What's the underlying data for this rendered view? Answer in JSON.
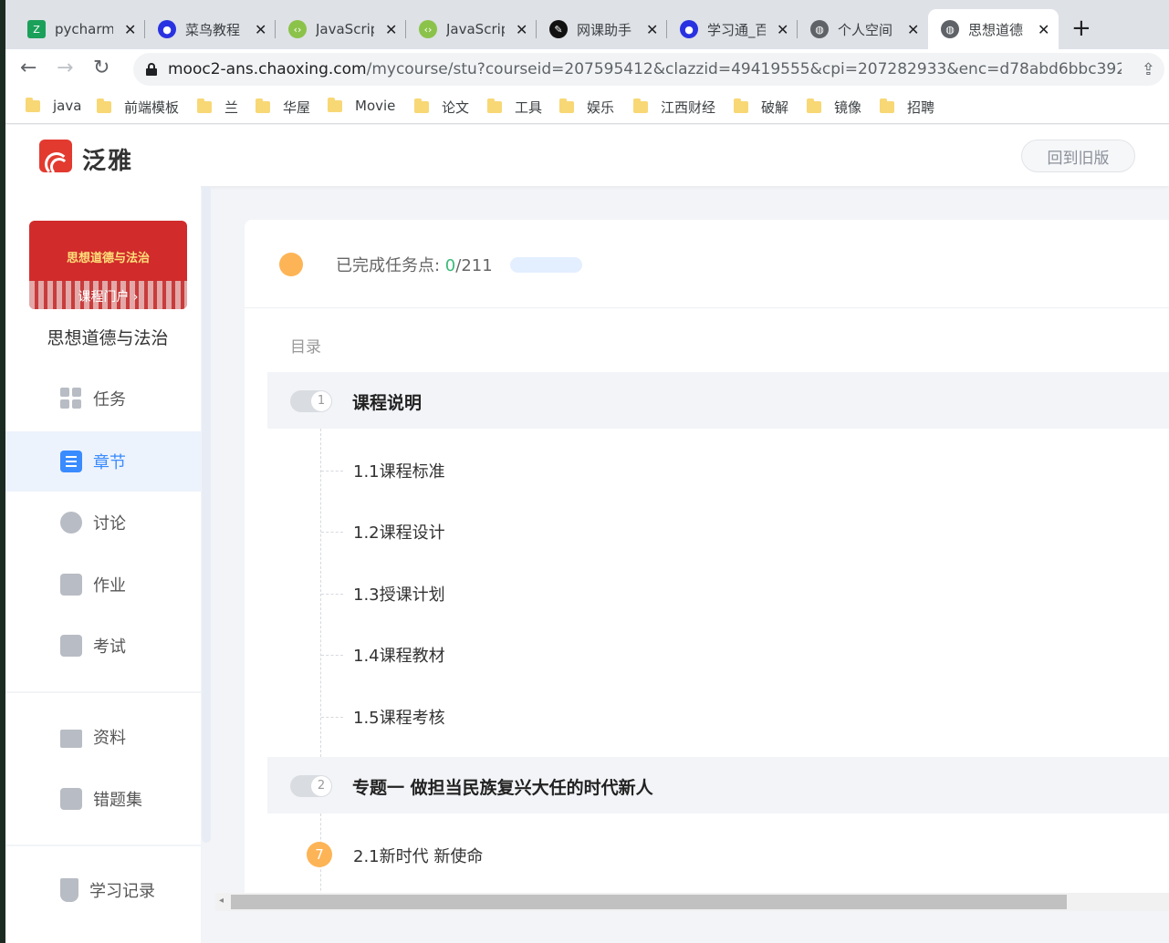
{
  "browser": {
    "tabs": [
      {
        "label": "pycharm",
        "icon": "zcool-icon",
        "color": "#1ba05a"
      },
      {
        "label": "菜鸟教程",
        "icon": "baidu-paw-icon",
        "color": "#2932e1"
      },
      {
        "label": "JavaScrip",
        "icon": "code-icon",
        "color": "#8bc34a"
      },
      {
        "label": "JavaScrip",
        "icon": "code-icon",
        "color": "#8bc34a"
      },
      {
        "label": "网课助手",
        "icon": "pen-icon",
        "color": "#111111"
      },
      {
        "label": "学习通_百",
        "icon": "baidu-paw-icon",
        "color": "#2932e1"
      },
      {
        "label": "个人空间",
        "icon": "globe-icon",
        "color": "#5f6368"
      },
      {
        "label": "思想道德",
        "icon": "globe-icon",
        "color": "#5f6368"
      }
    ],
    "url_host": "mooc2-ans.chaoxing.com",
    "url_rest": "/mycourse/stu?courseid=207595412&clazzid=49419555&cpi=207282933&enc=d78abd6bbc392...",
    "bookmarks": [
      "java",
      "前端模板",
      "兰",
      "华屋",
      "Movie",
      "论文",
      "工具",
      "娱乐",
      "江西财经",
      "破解",
      "镜像",
      "招聘"
    ]
  },
  "header": {
    "brand": "泛雅",
    "old_version_button": "回到旧版"
  },
  "sidebar": {
    "cover_title": "思想道德与法治",
    "cover_portal": "课程门户 ›",
    "course_name": "思想道德与法治",
    "items": [
      {
        "label": "任务"
      },
      {
        "label": "章节"
      },
      {
        "label": "讨论"
      },
      {
        "label": "作业"
      },
      {
        "label": "考试"
      },
      {
        "label": "资料"
      },
      {
        "label": "错题集"
      },
      {
        "label": "学习记录"
      }
    ]
  },
  "main": {
    "progress_label": "已完成任务点: ",
    "progress_done": "0",
    "progress_total": "/211",
    "progress_fraction": 0,
    "toc_label": "目录",
    "chapters": [
      {
        "num": "1",
        "title": "课程说明",
        "sections": [
          "1.1课程标准",
          "1.2课程设计",
          "1.3授课计划",
          "1.4课程教材",
          "1.5课程考核"
        ]
      },
      {
        "num": "2",
        "title": "专题一 做担当民族复兴大任的时代新人",
        "sections": [
          "2.1新时代 新使命"
        ],
        "badge": "7"
      }
    ]
  },
  "colors": {
    "accent": "#3a8bff",
    "done_green": "#3cba78",
    "orange": "#fdb456"
  }
}
